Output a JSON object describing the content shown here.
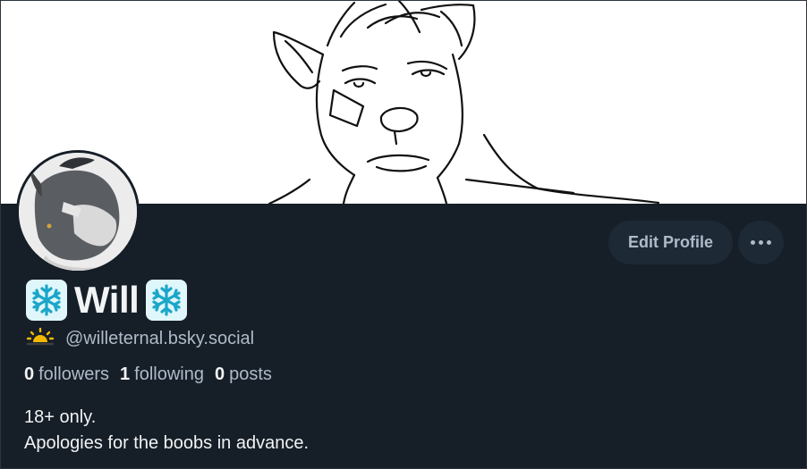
{
  "profile": {
    "display_name": "Will",
    "handle": "@willeternal.bsky.social",
    "name_prefix_icon": "snowflake-icon",
    "name_suffix_icon": "snowflake-icon",
    "handle_icon": "sunrise-icon"
  },
  "stats": {
    "followers_count": "0",
    "followers_label": "followers",
    "following_count": "1",
    "following_label": "following",
    "posts_count": "0",
    "posts_label": "posts"
  },
  "bio": {
    "line1": "18+ only.",
    "line2": "Apologies for the boobs in advance."
  },
  "actions": {
    "edit_profile_label": "Edit Profile",
    "more_icon": "more-horizontal-icon"
  },
  "colors": {
    "background": "#161e27",
    "button_bg": "#1e2936",
    "text_primary": "#f1f3f5",
    "text_secondary": "#aebbc9"
  }
}
